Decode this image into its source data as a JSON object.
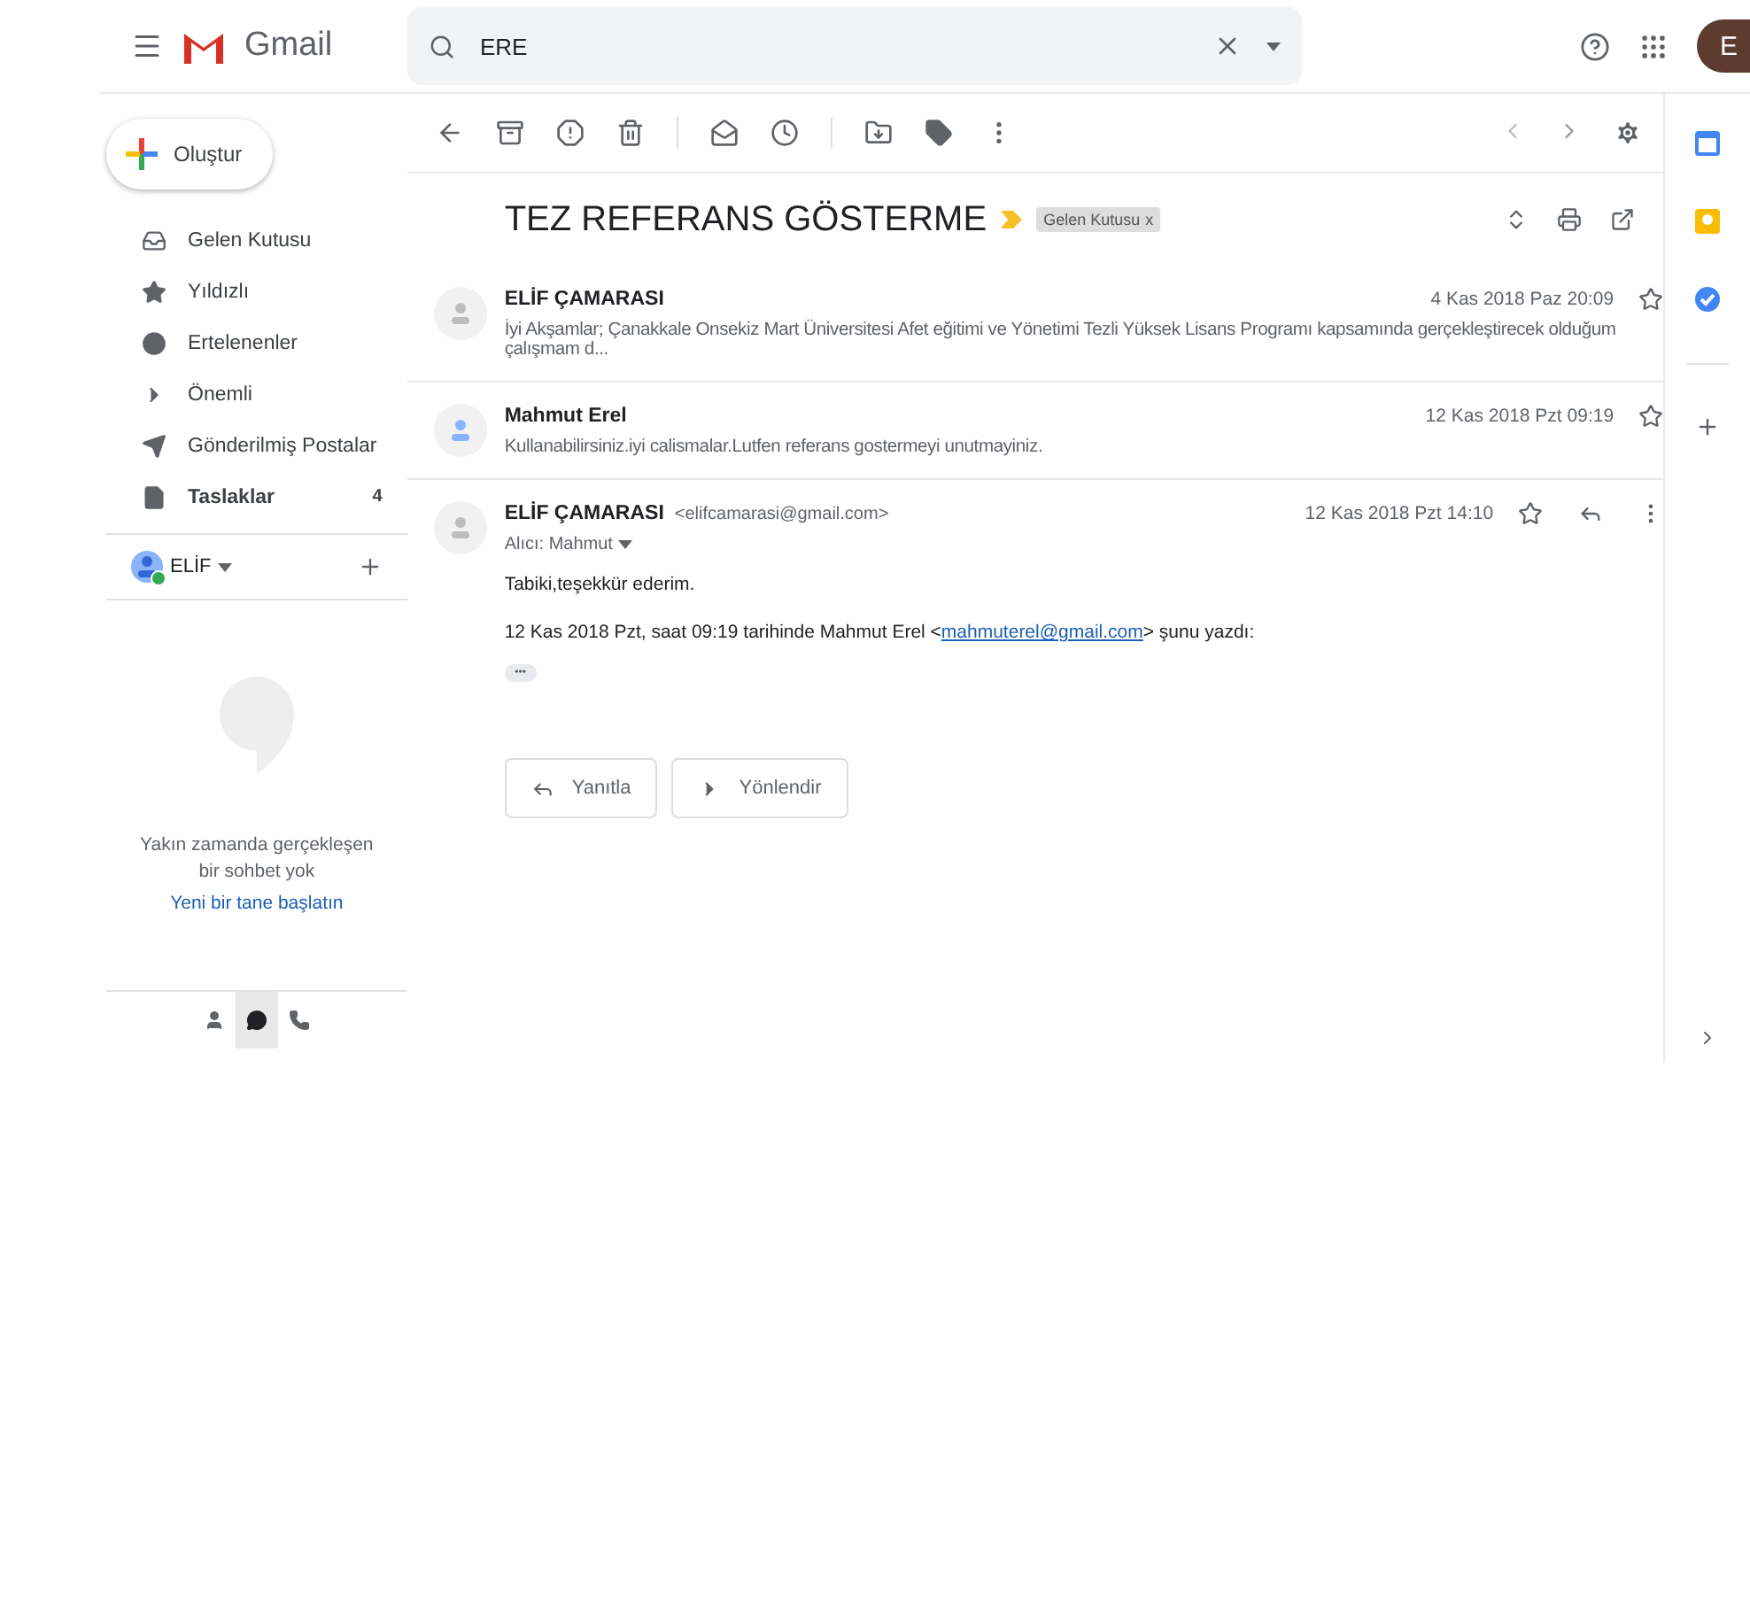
{
  "header": {
    "app_name": "Gmail",
    "search": {
      "value": "ERE"
    },
    "account_initial": "E"
  },
  "sidebar": {
    "compose": "Oluştur",
    "items": [
      {
        "kind": "inbox",
        "label": "Gelen Kutusu",
        "unread": false
      },
      {
        "kind": "starred",
        "label": "Yıldızlı",
        "unread": false
      },
      {
        "kind": "snoozed",
        "label": "Ertelenenler",
        "unread": false
      },
      {
        "kind": "important",
        "label": "Önemli",
        "unread": false
      },
      {
        "kind": "sent",
        "label": "Gönderilmiş Postalar",
        "unread": false
      },
      {
        "kind": "drafts",
        "label": "Taslaklar",
        "unread": true,
        "count": "4"
      }
    ],
    "chat_user": {
      "name": "ELİF",
      "online": true
    },
    "chat_empty": {
      "message": "Yakın zamanda gerçekleşen bir sohbet yok",
      "link": "Yeni bir tane başlatın"
    },
    "chat_tabs": [
      {
        "kind": "contacts",
        "selected": false
      },
      {
        "kind": "conversations",
        "selected": true
      },
      {
        "kind": "phone",
        "selected": false
      }
    ]
  },
  "thread": {
    "subject": "TEZ REFERANS GÖSTERME",
    "important": true,
    "label": "Gelen Kutusu",
    "label_close": "x",
    "messages": [
      {
        "kind": "collapsed",
        "sender": "ELİF ÇAMARASI",
        "color": "#bdbdbd",
        "date": "4 Kas 2018 Paz 20:09",
        "starred": false,
        "snippet": "İyi Akşamlar; Çanakkale Onsekiz Mart Üniversitesi Afet eğitimi ve Yönetimi Tezli Yüksek Lisans Programı kapsamında gerçekleştirecek olduğum çalışmam d..."
      },
      {
        "kind": "collapsed",
        "sender": "Mahmut Erel",
        "color": "#8ab4f8",
        "date": "12 Kas 2018 Pzt 09:19",
        "starred": false,
        "snippet": "Kullanabilirsiniz.iyi calismalar.Lutfen referans gostermeyi unutmayiniz."
      },
      {
        "kind": "expanded",
        "sender": "ELİF ÇAMARASI",
        "color": "#bdbdbd",
        "email": "<elifcamarasi@gmail.com>",
        "to": "Alıcı: Mahmut",
        "date": "12 Kas 2018 Pzt 14:10",
        "starred": false,
        "body": "Tabiki,teşekkür ederim.",
        "quote_before": "12 Kas 2018 Pzt, saat 09:19 tarihinde Mahmut Erel <",
        "quote_link": "mahmuterel@gmail.com",
        "quote_after": "> şunu yazdı:",
        "more": "•••"
      }
    ],
    "actions": [
      {
        "kind": "reply",
        "label": "Yanıtla"
      },
      {
        "kind": "forward",
        "label": "Yönlendir"
      }
    ]
  }
}
